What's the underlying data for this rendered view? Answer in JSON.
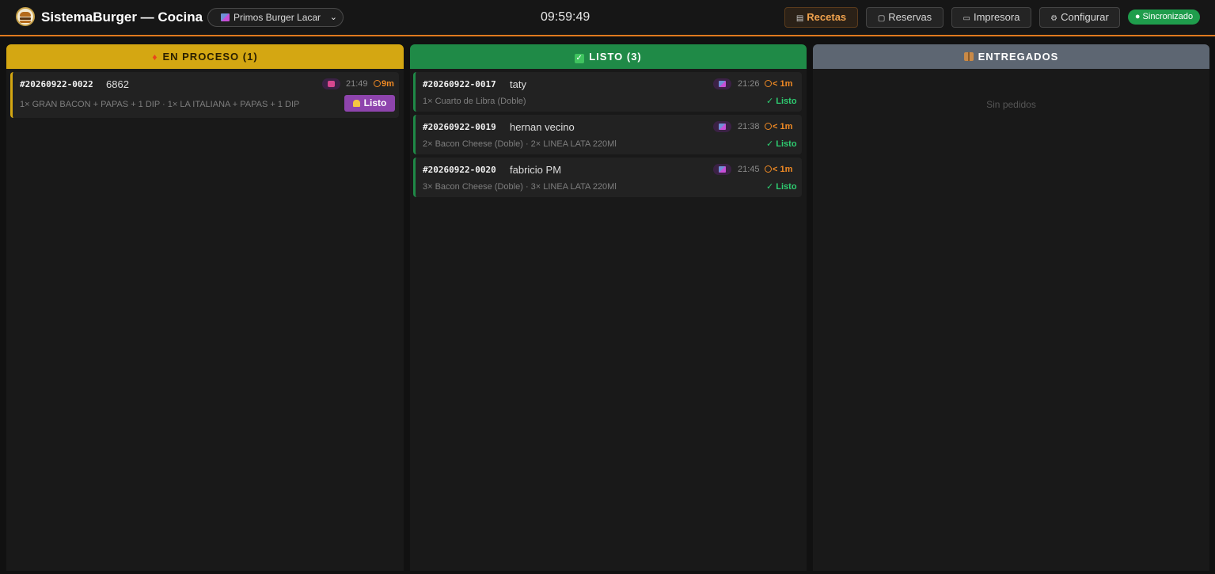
{
  "header": {
    "app_title": "SistemaBurger — Cocina",
    "store_selected": "Primos Burger Lacar",
    "clock": "09:59:49",
    "buttons": {
      "recetas": "Recetas",
      "reservas": "Reservas",
      "impresora": "Impresora",
      "configurar": "Configurar"
    },
    "sync_status": "● Sincronizado",
    "accent_color": "#e07a1f"
  },
  "columns": {
    "en_proceso": {
      "title": "EN PROCESO (1)",
      "color": "#d4a712",
      "orders": [
        {
          "number": "#20260922-0022",
          "name": "6862",
          "type_icon": "motorcycle-icon",
          "time": "21:49",
          "elapsed": "9m",
          "items": "1× GRAN BACON + PAPAS + 1 DIP · 1× LA ITALIANA + PAPAS + 1 DIP",
          "action_label": "Listo"
        }
      ]
    },
    "listo": {
      "title": "LISTO (3)",
      "color": "#1f8a47",
      "orders": [
        {
          "number": "#20260922-0017",
          "name": "taty",
          "type_icon": "shopping-bag-icon",
          "time": "21:26",
          "elapsed": "< 1m",
          "items": "1× Cuarto de Libra (Doble)",
          "status": "✓ Listo"
        },
        {
          "number": "#20260922-0019",
          "name": "hernan vecino",
          "type_icon": "shopping-bag-icon",
          "time": "21:38",
          "elapsed": "< 1m",
          "items": "2× Bacon Cheese (Doble) · 2× LINEA LATA 220Ml",
          "status": "✓ Listo"
        },
        {
          "number": "#20260922-0020",
          "name": "fabricio PM",
          "type_icon": "shopping-bag-icon",
          "time": "21:45",
          "elapsed": "< 1m",
          "items": "3× Bacon Cheese (Doble) · 3× LINEA LATA 220Ml",
          "status": "✓ Listo"
        }
      ]
    },
    "entregados": {
      "title": "ENTREGADOS",
      "color": "#5d6672",
      "empty_text": "Sin pedidos"
    }
  }
}
